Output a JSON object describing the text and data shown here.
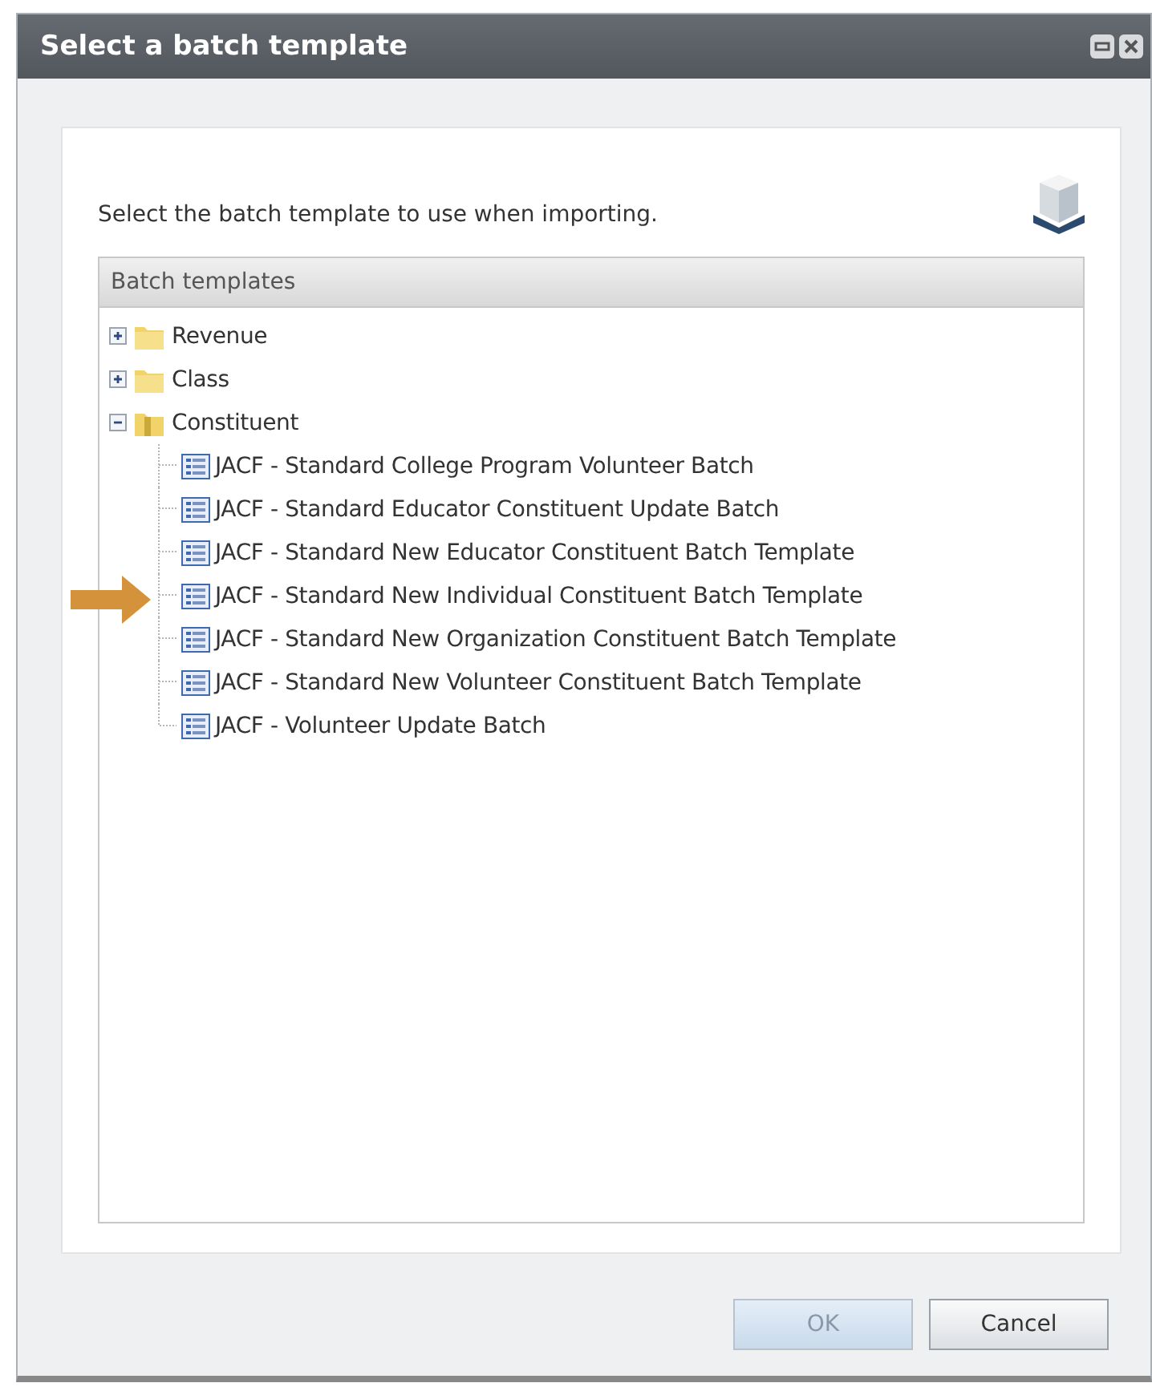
{
  "window": {
    "title": "Select a batch template"
  },
  "instruction": "Select the batch template to use when importing.",
  "tree": {
    "header": "Batch templates",
    "items": [
      {
        "kind": "folder",
        "label": "Revenue",
        "expanded": false
      },
      {
        "kind": "folder",
        "label": "Class",
        "expanded": false
      },
      {
        "kind": "folder",
        "label": "Constituent",
        "expanded": true,
        "children": [
          {
            "kind": "template",
            "label": "JACF - Standard College Program Volunteer Batch"
          },
          {
            "kind": "template",
            "label": "JACF - Standard Educator Constituent Update Batch"
          },
          {
            "kind": "template",
            "label": "JACF - Standard New Educator Constituent Batch Template"
          },
          {
            "kind": "template",
            "label": "JACF - Standard New Individual Constituent Batch Template"
          },
          {
            "kind": "template",
            "label": "JACF - Standard New Organization Constituent Batch Template"
          },
          {
            "kind": "template",
            "label": "JACF - Standard New Volunteer Constituent Batch Template"
          },
          {
            "kind": "template",
            "label": "JACF - Volunteer Update Batch"
          }
        ]
      }
    ]
  },
  "buttons": [
    {
      "label": "OK",
      "disabled": true
    },
    {
      "label": "Cancel",
      "disabled": false
    }
  ]
}
